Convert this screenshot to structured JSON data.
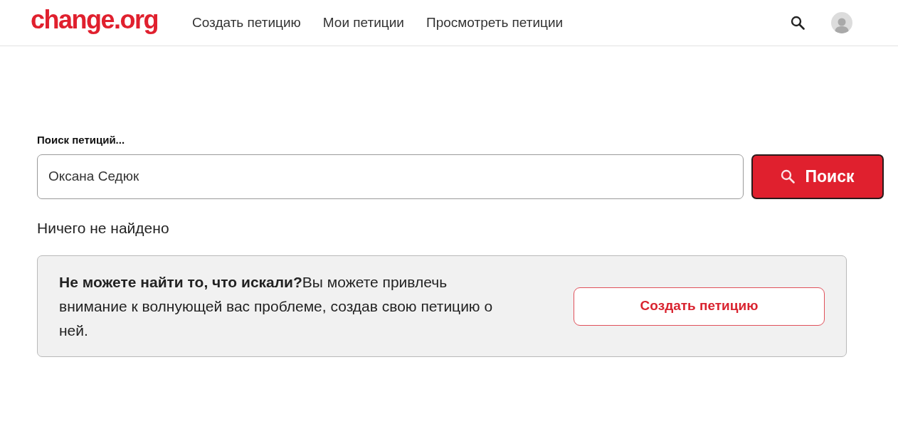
{
  "header": {
    "logo": "change.org",
    "nav": [
      "Создать петицию",
      "Мои петиции",
      "Просмотреть петиции"
    ]
  },
  "search": {
    "label": "Поиск петиций...",
    "value": "Оксана Седюк",
    "button": "Поиск"
  },
  "results": {
    "message": "Ничего не найдено"
  },
  "prompt": {
    "text": "**Не можете найти то, что искали?**Вы можете привлечь внимание к волнующей вас проблеме, создав свою петицию о ней.",
    "button": "Создать петицию"
  }
}
